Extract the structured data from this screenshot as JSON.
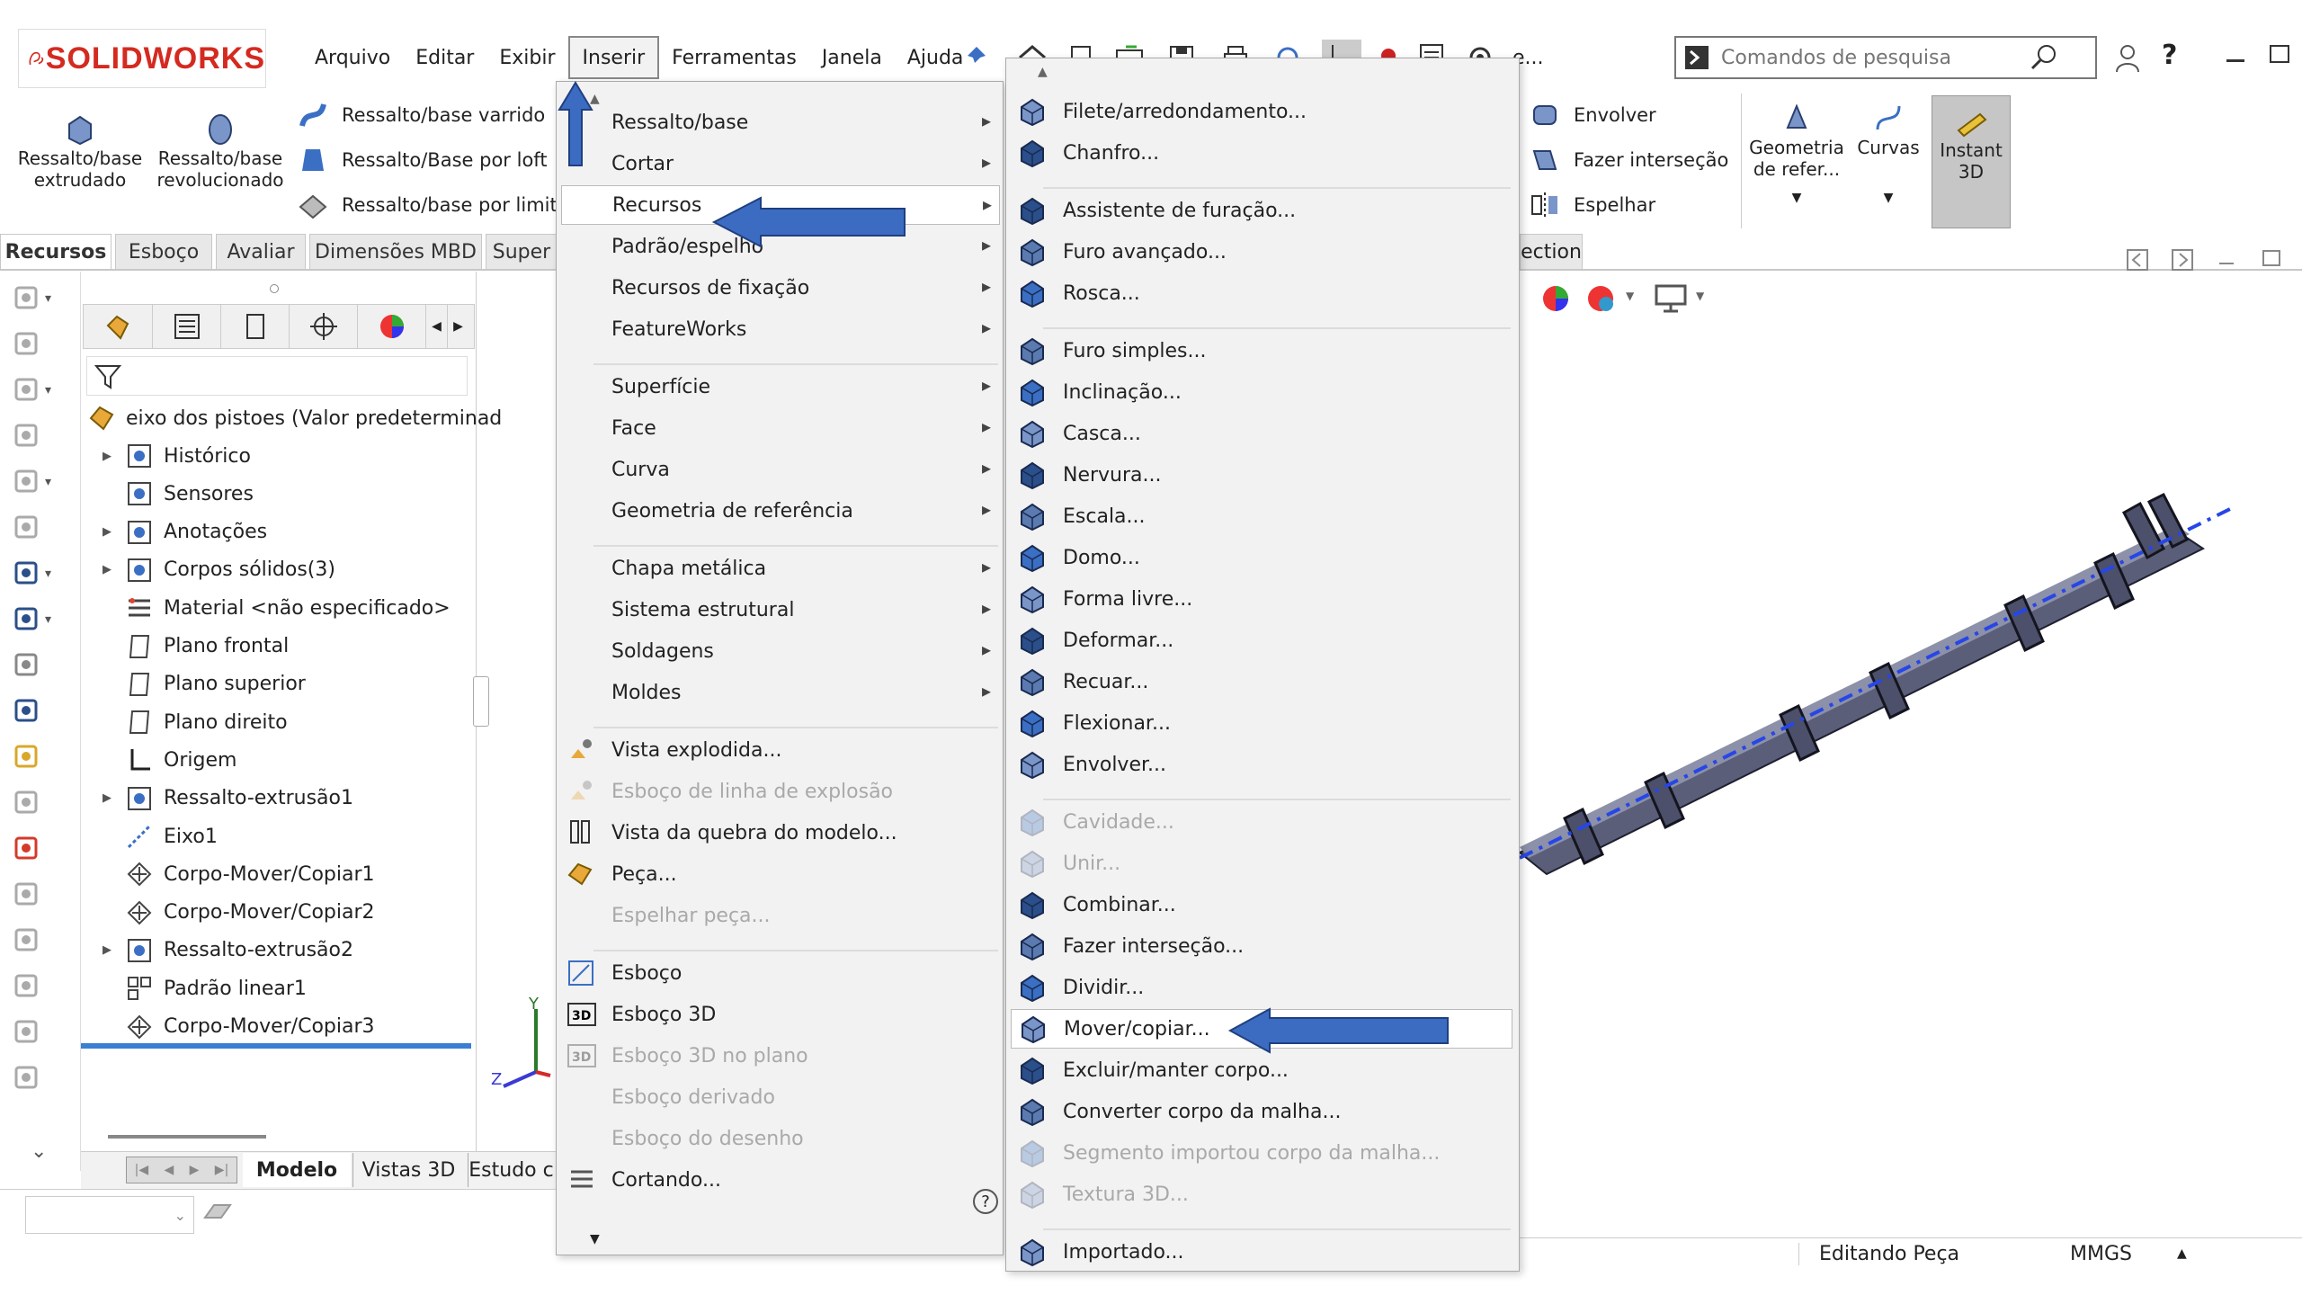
{
  "app": {
    "logo_text": "SOLIDWORKS",
    "menu_bar": [
      "Arquivo",
      "Editar",
      "Exibir",
      "Inserir",
      "Ferramentas",
      "Janela",
      "Ajuda"
    ],
    "active_menu": "Inserir",
    "search_placeholder": "Comandos de pesquisa",
    "toolbar_ellipsis": "e..."
  },
  "ribbon": {
    "big_buttons": [
      {
        "label": "Ressalto/base\nextrudado"
      },
      {
        "label": "Ressalto/base\nrevolucionado"
      }
    ],
    "small_buttons": [
      "Ressalto/base varrido",
      "Ressalto/Base por loft",
      "Ressalto/base por limite"
    ],
    "right_small": [
      "Envolver",
      "Fazer interseção",
      "Espelhar"
    ],
    "right_big": [
      {
        "label": "Geometria\nde refer..."
      },
      {
        "label": "Curvas"
      },
      {
        "label": "Instant\n3D"
      }
    ]
  },
  "cmd_tabs": [
    "Recursos",
    "Esboço",
    "Avaliar",
    "Dimensões MBD",
    "Super"
  ],
  "right_tab_fragment": "ection",
  "tree": {
    "root": "eixo dos pistoes  (Valor predeterminad",
    "items": [
      {
        "label": "Histórico",
        "expander": true
      },
      {
        "label": "Sensores",
        "expander": false
      },
      {
        "label": "Anotações",
        "expander": true
      },
      {
        "label": "Corpos sólidos(3)",
        "expander": true
      },
      {
        "label": "Material <não especificado>",
        "expander": false
      },
      {
        "label": "Plano frontal",
        "expander": false
      },
      {
        "label": "Plano superior",
        "expander": false
      },
      {
        "label": "Plano direito",
        "expander": false
      },
      {
        "label": "Origem",
        "expander": false
      },
      {
        "label": "Ressalto-extrusão1",
        "expander": true
      },
      {
        "label": "Eixo1",
        "expander": false
      },
      {
        "label": "Corpo-Mover/Copiar1",
        "expander": false
      },
      {
        "label": "Corpo-Mover/Copiar2",
        "expander": false
      },
      {
        "label": "Ressalto-extrusão2",
        "expander": true
      },
      {
        "label": "Padrão linear1",
        "expander": false
      },
      {
        "label": "Corpo-Mover/Copiar3",
        "expander": false
      }
    ]
  },
  "bottom_tabs": [
    "Modelo",
    "Vistas 3D",
    "Estudo c"
  ],
  "status": {
    "editing": "Editando Peça",
    "units": "MMGS"
  },
  "triad": {
    "y": "Y",
    "z": "Z"
  },
  "insert_menu": {
    "groups": [
      [
        {
          "label": "Ressalto/base",
          "sub": true,
          "disabled": false
        },
        {
          "label": "Cortar",
          "sub": true,
          "disabled": false
        },
        {
          "label": "Recursos",
          "sub": true,
          "disabled": false,
          "highlighted": true
        },
        {
          "label": "Padrão/espelho",
          "sub": true,
          "disabled": false
        },
        {
          "label": "Recursos de fixação",
          "sub": true,
          "disabled": false
        },
        {
          "label": "FeatureWorks",
          "sub": true,
          "disabled": false
        }
      ],
      [
        {
          "label": "Superfície",
          "sub": true,
          "disabled": false
        },
        {
          "label": "Face",
          "sub": true,
          "disabled": false
        },
        {
          "label": "Curva",
          "sub": true,
          "disabled": false
        },
        {
          "label": "Geometria de referência",
          "sub": true,
          "disabled": false
        }
      ],
      [
        {
          "label": "Chapa metálica",
          "sub": true,
          "disabled": false
        },
        {
          "label": "Sistema estrutural",
          "sub": true,
          "disabled": false
        },
        {
          "label": "Soldagens",
          "sub": true,
          "disabled": false
        },
        {
          "label": "Moldes",
          "sub": true,
          "disabled": false
        }
      ],
      [
        {
          "label": "Vista explodida...",
          "sub": false,
          "disabled": false,
          "icon": "explode"
        },
        {
          "label": "Esboço de linha de explosão",
          "sub": false,
          "disabled": true,
          "icon": "explode"
        },
        {
          "label": "Vista da quebra do modelo...",
          "sub": false,
          "disabled": false,
          "icon": "break"
        },
        {
          "label": "Peça...",
          "sub": false,
          "disabled": false,
          "icon": "part"
        },
        {
          "label": "Espelhar peça...",
          "sub": false,
          "disabled": true,
          "icon": ""
        }
      ],
      [
        {
          "label": "Esboço",
          "sub": false,
          "disabled": false,
          "icon": "sketch"
        },
        {
          "label": "Esboço 3D",
          "sub": false,
          "disabled": false,
          "icon": "3d"
        },
        {
          "label": "Esboço 3D no plano",
          "sub": false,
          "disabled": true,
          "icon": "3d"
        },
        {
          "label": "Esboço derivado",
          "sub": false,
          "disabled": true,
          "icon": ""
        },
        {
          "label": "Esboço do desenho",
          "sub": false,
          "disabled": true,
          "icon": ""
        },
        {
          "label": "Cortando...",
          "sub": false,
          "disabled": false,
          "icon": "slice"
        }
      ]
    ]
  },
  "features_menu": {
    "groups": [
      [
        "Filete/arredondamento...",
        "Chanfro..."
      ],
      [
        "Assistente de furação...",
        "Furo avançado...",
        "Rosca..."
      ],
      [
        "Furo simples...",
        "Inclinação...",
        "Casca...",
        "Nervura...",
        "Escala...",
        "Domo...",
        "Forma livre...",
        "Deformar...",
        "Recuar...",
        "Flexionar...",
        "Envolver..."
      ],
      [
        "Cavidade...",
        "Unir...",
        "Combinar...",
        "Fazer interseção...",
        "Dividir...",
        "Mover/copiar...",
        "Excluir/manter corpo...",
        "Converter corpo da malha...",
        "Segmento importou corpo da malha...",
        "Textura 3D..."
      ],
      [
        "Importado..."
      ]
    ],
    "disabled": [
      "Cavidade...",
      "Unir...",
      "Segmento importou corpo da malha...",
      "Textura 3D..."
    ],
    "highlighted": "Mover/copiar..."
  },
  "colors": {
    "accent": "#3a6fc4",
    "arrow": "#3b6cc1",
    "shaft": "#5a5e78",
    "axis": "#2646e8"
  }
}
